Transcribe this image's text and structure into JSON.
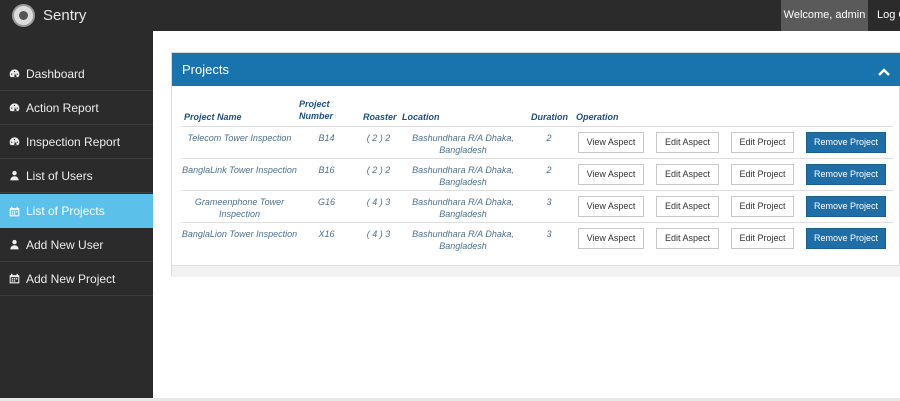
{
  "app": {
    "name": "Sentry",
    "welcome": "Welcome, admin",
    "logout": "Log Out"
  },
  "sidebar": {
    "items": [
      {
        "label": "Dashboard",
        "icon": "dashboard-icon"
      },
      {
        "label": "Action Report",
        "icon": "dashboard-icon"
      },
      {
        "label": "Inspection Report",
        "icon": "dashboard-icon"
      },
      {
        "label": "List of Users",
        "icon": "user-icon"
      },
      {
        "label": "List of Projects",
        "icon": "calendar-icon",
        "active": true
      },
      {
        "label": "Add New User",
        "icon": "user-icon"
      },
      {
        "label": "Add New Project",
        "icon": "calendar-icon"
      }
    ]
  },
  "panel": {
    "title": "Projects",
    "columns": {
      "name": "Project Name",
      "number_line1": "Project",
      "number_line2": "Number",
      "roaster": "Roaster",
      "location": "Location",
      "duration": "Duration",
      "operation": "Operation"
    },
    "rows": [
      {
        "name_line1": "Telecom Tower Inspection",
        "name_line2": "",
        "number": "B14",
        "roaster": "( 2 ) 2",
        "location_line1": "Bashundhara R/A Dhaka,",
        "location_line2": "Bangladesh",
        "duration": "2"
      },
      {
        "name_line1": "BanglaLink Tower Inspection",
        "name_line2": "",
        "number": "B16",
        "roaster": "( 2 ) 2",
        "location_line1": "Bashundhara R/A Dhaka,",
        "location_line2": "Bangladesh",
        "duration": "2"
      },
      {
        "name_line1": "Grameenphone Tower",
        "name_line2": "Inspection",
        "number": "G16",
        "roaster": "( 4 ) 3",
        "location_line1": "Bashundhara R/A Dhaka,",
        "location_line2": "Bangladesh",
        "duration": "3"
      },
      {
        "name_line1": "BanglaLion Tower Inspection",
        "name_line2": "",
        "number": "X16",
        "roaster": "( 4 ) 3",
        "location_line1": "Bashundhara R/A Dhaka,",
        "location_line2": "Bangladesh",
        "duration": "3"
      }
    ],
    "actions": {
      "view": "View Aspect",
      "edit_aspect": "Edit Aspect",
      "edit_project": "Edit Project",
      "remove": "Remove Project"
    }
  },
  "colors": {
    "topbar": "#2b2b2b",
    "sidebar": "#2b2b2b",
    "active_nav": "#5bc0ea",
    "panel_header": "#1973ad",
    "primary_button": "#1f6ea8"
  }
}
